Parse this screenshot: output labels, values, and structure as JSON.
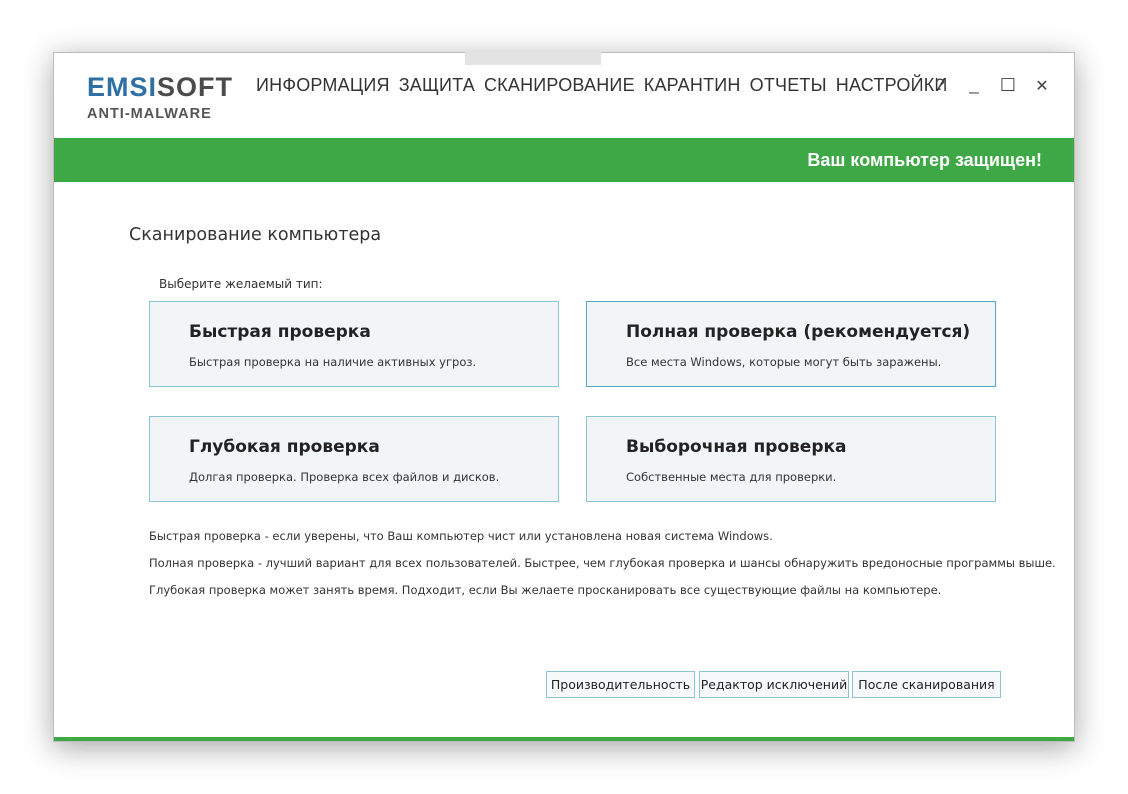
{
  "logo": {
    "part1": "EMSI",
    "part2": "SOFT",
    "sub": "ANTI-MALWARE"
  },
  "nav": {
    "items": [
      {
        "label": "ИНФОРМАЦИЯ"
      },
      {
        "label": "ЗАЩИТА"
      },
      {
        "label": "СКАНИРОВАНИЕ"
      },
      {
        "label": "КАРАНТИН"
      },
      {
        "label": "ОТЧЕТЫ"
      },
      {
        "label": "НАСТРОЙКИ"
      }
    ],
    "active": "СКАНИРОВАНИЕ"
  },
  "window_controls": {
    "help": "?",
    "minimize": "_",
    "maximize": "☐",
    "close": "✕"
  },
  "status": {
    "text": "Ваш компьютер защищен!",
    "color": "#3ea847"
  },
  "main": {
    "title": "Сканирование компьютера",
    "select_label": "Выберите желаемый тип:",
    "cards": [
      {
        "title": "Быстрая проверка",
        "desc": "Быстрая проверка на наличие активных угроз."
      },
      {
        "title": "Полная проверка (рекомендуется)",
        "desc": "Все места Windows, которые могут быть заражены."
      },
      {
        "title": "Глубокая проверка",
        "desc": "Долгая проверка. Проверка всех файлов и дисков."
      },
      {
        "title": "Выборочная проверка",
        "desc": "Собственные места для проверки."
      }
    ],
    "info": [
      "Быстрая проверка - если уверены, что Ваш компьютер чист или установлена новая система Windows.",
      "Полная проверка - лучший вариант для всех пользователей. Быстрее, чем глубокая проверка и шансы обнаружить вредоносные программы выше.",
      "Глубокая проверка может занять время. Подходит, если Вы желаете просканировать все существующие файлы на компьютере."
    ],
    "buttons": [
      {
        "label": "Производительность"
      },
      {
        "label": "Редактор исключений"
      },
      {
        "label": "После сканирования"
      }
    ]
  },
  "colors": {
    "accent_green": "#3ea847",
    "logo_blue": "#2f6fa3",
    "card_border": "#8dc3d3"
  }
}
